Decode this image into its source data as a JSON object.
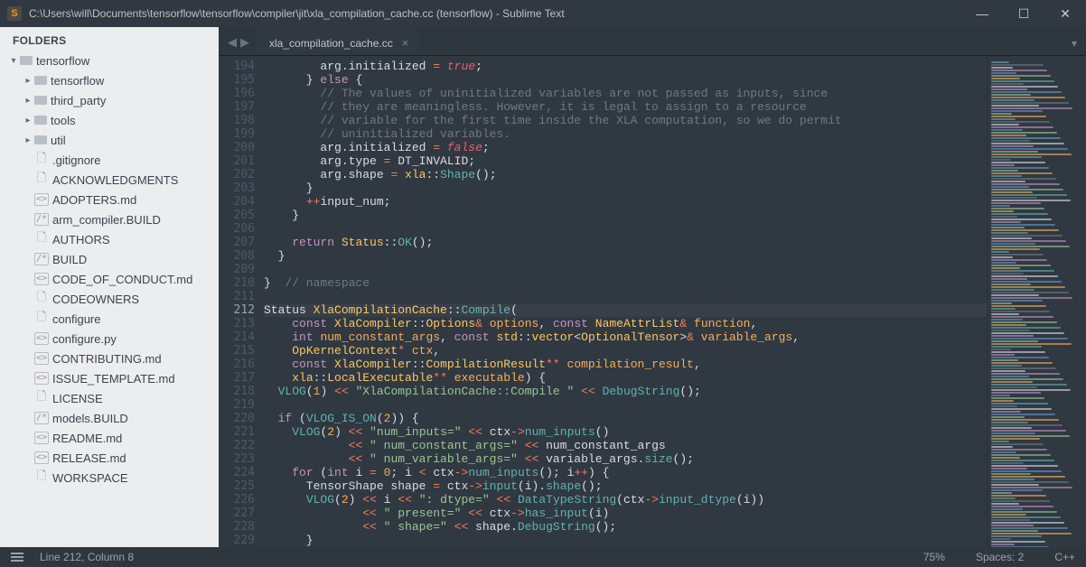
{
  "window": {
    "title": "C:\\Users\\will\\Documents\\tensorflow\\tensorflow\\compiler\\jit\\xla_compilation_cache.cc (tensorflow) - Sublime Text",
    "logo_letter": "S"
  },
  "sidebar": {
    "heading": "FOLDERS",
    "root": "tensorflow",
    "folders": [
      "tensorflow",
      "third_party",
      "tools",
      "util"
    ],
    "files": [
      {
        "icon": "🗋",
        "name": ".gitignore"
      },
      {
        "icon": "🗋",
        "name": "ACKNOWLEDGMENTS"
      },
      {
        "icon": "<>",
        "name": "ADOPTERS.md"
      },
      {
        "icon": "/*",
        "name": "arm_compiler.BUILD"
      },
      {
        "icon": "🗋",
        "name": "AUTHORS"
      },
      {
        "icon": "/*",
        "name": "BUILD"
      },
      {
        "icon": "<>",
        "name": "CODE_OF_CONDUCT.md"
      },
      {
        "icon": "🗋",
        "name": "CODEOWNERS"
      },
      {
        "icon": "🗋",
        "name": "configure"
      },
      {
        "icon": "<>",
        "name": "configure.py"
      },
      {
        "icon": "<>",
        "name": "CONTRIBUTING.md"
      },
      {
        "icon": "<>",
        "name": "ISSUE_TEMPLATE.md"
      },
      {
        "icon": "🗋",
        "name": "LICENSE"
      },
      {
        "icon": "/*",
        "name": "models.BUILD"
      },
      {
        "icon": "<>",
        "name": "README.md"
      },
      {
        "icon": "<>",
        "name": "RELEASE.md"
      },
      {
        "icon": "🗋",
        "name": "WORKSPACE"
      }
    ]
  },
  "tab": {
    "label": "xla_compilation_cache.cc"
  },
  "code": {
    "first_line": 194,
    "current_line": 212,
    "lines": [
      {
        "n": 194,
        "html": "        arg.initialized <span class='o'>=</span> <span class='bool'>true</span>;"
      },
      {
        "n": 195,
        "html": "      } <span class='k'>else</span> {"
      },
      {
        "n": 196,
        "html": "        <span class='c'>// The values of uninitialized variables are not passed as inputs, since</span>"
      },
      {
        "n": 197,
        "html": "        <span class='c'>// they are meaningless. However, it is legal to assign to a resource</span>"
      },
      {
        "n": 198,
        "html": "        <span class='c'>// variable for the first time inside the XLA computation, so we do permit</span>"
      },
      {
        "n": 199,
        "html": "        <span class='c'>// uninitialized variables.</span>"
      },
      {
        "n": 200,
        "html": "        arg.initialized <span class='o'>=</span> <span class='bool'>false</span>;"
      },
      {
        "n": 201,
        "html": "        arg.type <span class='o'>=</span> DT_INVALID;"
      },
      {
        "n": 202,
        "html": "        arg.shape <span class='o'>=</span> <span class='y'>xla</span>::<span class='f'>Shape</span>();"
      },
      {
        "n": 203,
        "html": "      }"
      },
      {
        "n": 204,
        "html": "      <span class='o'>++</span>input_num;"
      },
      {
        "n": 205,
        "html": "    }"
      },
      {
        "n": 206,
        "html": ""
      },
      {
        "n": 207,
        "html": "    <span class='k'>return</span> <span class='y'>Status</span>::<span class='f'>OK</span>();"
      },
      {
        "n": 208,
        "html": "  }"
      },
      {
        "n": 209,
        "html": ""
      },
      {
        "n": 210,
        "html": "}  <span class='c'>// namespace</span>"
      },
      {
        "n": 211,
        "html": ""
      },
      {
        "n": 212,
        "html": "Status <span class='y'>XlaCompilationCache</span>::<span class='f'>Compile</span>("
      },
      {
        "n": 213,
        "html": "    <span class='k'>const</span> <span class='y'>XlaCompiler</span>::<span class='y'>Options</span><span class='o'>&amp;</span> <span class='n'>options</span>, <span class='k'>const</span> <span class='y'>NameAttrList</span><span class='o'>&amp;</span> <span class='n'>function</span>,"
      },
      {
        "n": 214,
        "html": "    <span class='k'>int</span> <span class='n'>num_constant_args</span>, <span class='k'>const</span> <span class='y'>std</span>::<span class='y'>vector</span>&lt;<span class='y'>OptionalTensor</span>&gt;<span class='o'>&amp;</span> <span class='n'>variable_args</span>,"
      },
      {
        "n": 215,
        "html": "    <span class='y'>OpKernelContext</span><span class='o'>*</span> <span class='n'>ctx</span>,"
      },
      {
        "n": 216,
        "html": "    <span class='k'>const</span> <span class='y'>XlaCompiler</span>::<span class='y'>CompilationResult</span><span class='o'>**</span> <span class='n'>compilation_result</span>,"
      },
      {
        "n": 217,
        "html": "    <span class='y'>xla</span>::<span class='y'>LocalExecutable</span><span class='o'>**</span> <span class='n'>executable</span>) {"
      },
      {
        "n": 218,
        "html": "  <span class='f'>VLOG</span>(<span class='n'>1</span>) <span class='o'>&lt;&lt;</span> <span class='s'>\"XlaCompilationCache::Compile \"</span> <span class='o'>&lt;&lt;</span> <span class='f'>DebugString</span>();"
      },
      {
        "n": 219,
        "html": ""
      },
      {
        "n": 220,
        "html": "  <span class='k'>if</span> (<span class='f'>VLOG_IS_ON</span>(<span class='n'>2</span>)) {"
      },
      {
        "n": 221,
        "html": "    <span class='f'>VLOG</span>(<span class='n'>2</span>) <span class='o'>&lt;&lt;</span> <span class='s'>\"num_inputs=\"</span> <span class='o'>&lt;&lt;</span> ctx<span class='o'>-&gt;</span><span class='f'>num_inputs</span>()"
      },
      {
        "n": 222,
        "html": "            <span class='o'>&lt;&lt;</span> <span class='s'>\" num_constant_args=\"</span> <span class='o'>&lt;&lt;</span> num_constant_args"
      },
      {
        "n": 223,
        "html": "            <span class='o'>&lt;&lt;</span> <span class='s'>\" num_variable_args=\"</span> <span class='o'>&lt;&lt;</span> variable_args.<span class='f'>size</span>();"
      },
      {
        "n": 224,
        "html": "    <span class='k'>for</span> (<span class='k'>int</span> i <span class='o'>=</span> <span class='n'>0</span>; i <span class='o'>&lt;</span> ctx<span class='o'>-&gt;</span><span class='f'>num_inputs</span>(); i<span class='o'>++</span>) {"
      },
      {
        "n": 225,
        "html": "      TensorShape shape <span class='o'>=</span> ctx<span class='o'>-&gt;</span><span class='f'>input</span>(i).<span class='f'>shape</span>();"
      },
      {
        "n": 226,
        "html": "      <span class='f'>VLOG</span>(<span class='n'>2</span>) <span class='o'>&lt;&lt;</span> i <span class='o'>&lt;&lt;</span> <span class='s'>\": dtype=\"</span> <span class='o'>&lt;&lt;</span> <span class='f'>DataTypeString</span>(ctx<span class='o'>-&gt;</span><span class='f'>input_dtype</span>(i))"
      },
      {
        "n": 227,
        "html": "              <span class='o'>&lt;&lt;</span> <span class='s'>\" present=\"</span> <span class='o'>&lt;&lt;</span> ctx<span class='o'>-&gt;</span><span class='f'>has_input</span>(i)"
      },
      {
        "n": 228,
        "html": "              <span class='o'>&lt;&lt;</span> <span class='s'>\" shape=\"</span> <span class='o'>&lt;&lt;</span> shape.<span class='f'>DebugString</span>();"
      },
      {
        "n": 229,
        "html": "      }"
      }
    ]
  },
  "status": {
    "position": "Line 212, Column 8",
    "zoom": "75%",
    "spaces": "Spaces: 2",
    "lang": "C++"
  }
}
